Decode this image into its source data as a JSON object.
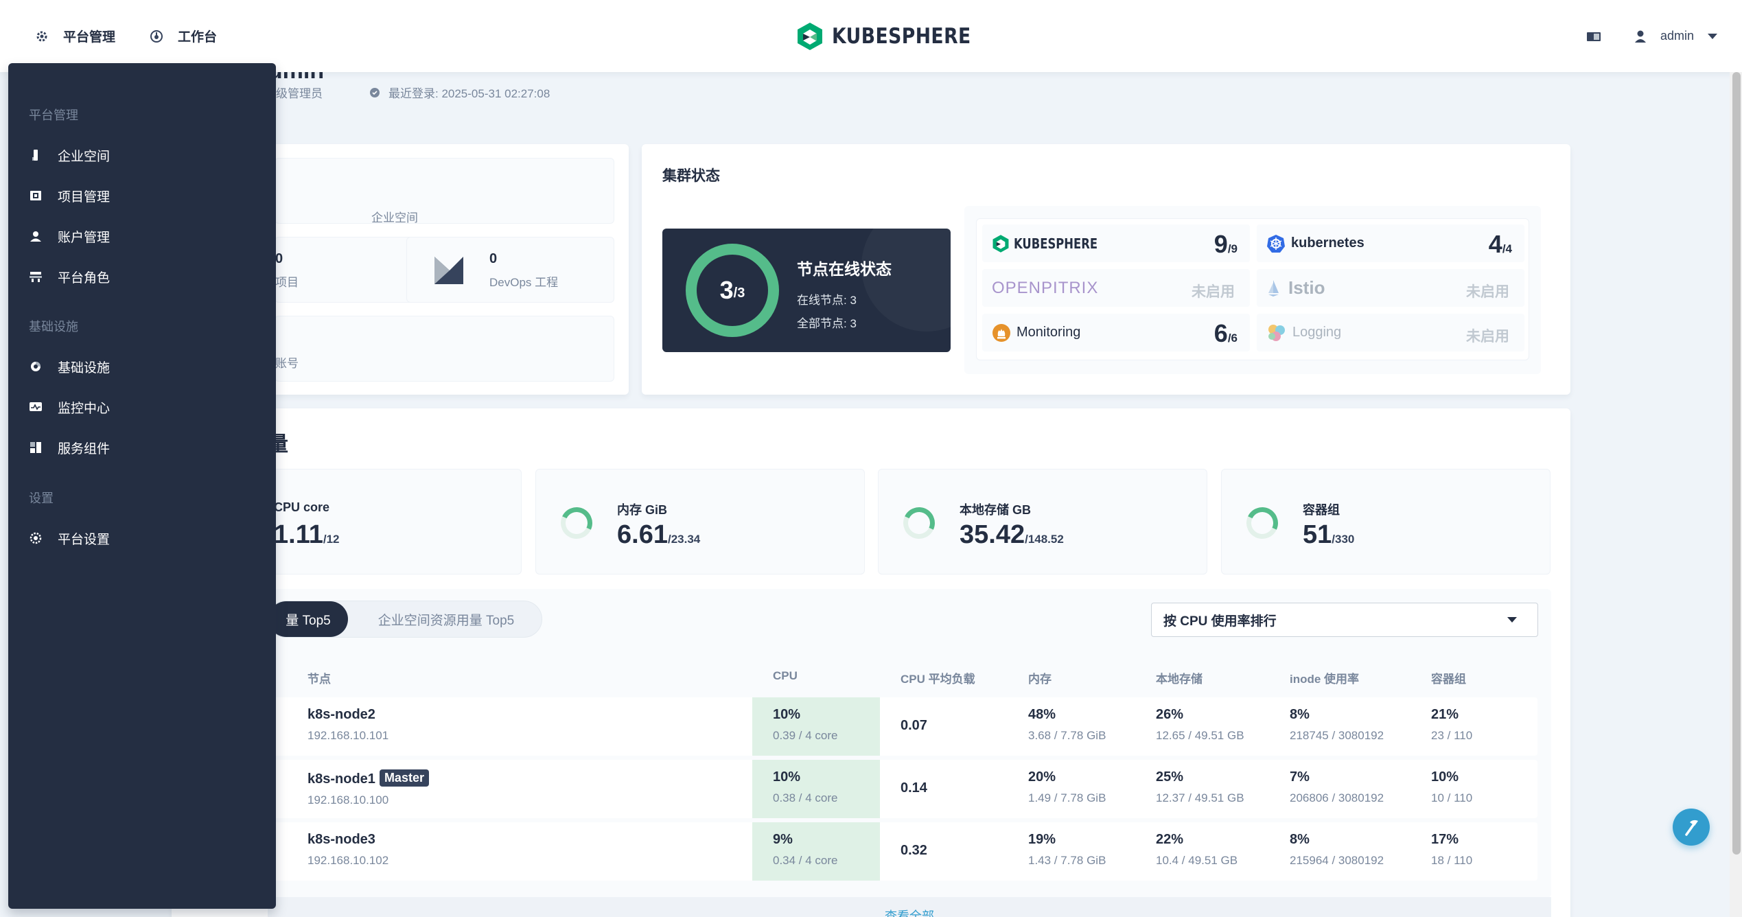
{
  "header": {
    "platform_label": "平台管理",
    "workbench_label": "工作台",
    "logo_text": "KUBESPHERE",
    "user": "admin"
  },
  "welcome": {
    "title_fragment": "admin",
    "role_fragment": "级管理员",
    "last_login": "最近登录: 2025-05-31 02:27:08"
  },
  "overview": {
    "workspace_label_fragment": "企业空间",
    "projects_value": "0",
    "projects_label_fragment": "项目",
    "devops_value": "0",
    "devops_label": "DevOps 工程",
    "accounts_label_fragment": "账号"
  },
  "cluster_status": {
    "title": "集群状态",
    "online_num": "3",
    "total_num": "/3",
    "heading": "节点在线状态",
    "online_label": "在线节点: 3",
    "total_label": "全部节点: 3",
    "components": [
      {
        "name": "KUBESPHERE",
        "value": "9",
        "total": "/9",
        "enabled": true
      },
      {
        "name": "kubernetes",
        "value": "4",
        "total": "/4",
        "enabled": true
      },
      {
        "name": "OPENPITRIX",
        "status": "未启用",
        "enabled": false
      },
      {
        "name": "Istio",
        "status": "未启用",
        "enabled": false
      },
      {
        "name": "Monitoring",
        "value": "6",
        "total": "/6",
        "enabled": true
      },
      {
        "name": "Logging",
        "status": "未启用",
        "enabled": false
      }
    ]
  },
  "resources": {
    "section_title_fragment": "量",
    "cpu": {
      "label": "CPU core",
      "value": "1.11",
      "total": "/12",
      "usage": 0.09
    },
    "memory": {
      "label": "内存 GiB",
      "value": "6.61",
      "total": "/23.34",
      "usage": 0.28
    },
    "storage": {
      "label": "本地存储 GB",
      "value": "35.42",
      "total": "/148.52",
      "usage": 0.24
    },
    "pods": {
      "label": "容器组",
      "value": "51",
      "total": "/330",
      "usage": 0.15
    }
  },
  "tabs": {
    "active": "量 Top5",
    "inactive": "企业空间资源用量 Top5"
  },
  "sort_select": {
    "value": "按 CPU 使用率排行"
  },
  "table": {
    "headers": {
      "node": "节点",
      "cpu": "CPU",
      "load": "CPU 平均负载",
      "memory": "内存",
      "storage": "本地存储",
      "inode": "inode 使用率",
      "pods": "容器组"
    },
    "rows": [
      {
        "name": "k8s-node2",
        "ip": "192.168.10.101",
        "badge": "",
        "cpu": "10%",
        "cpu_sub": "0.39 / 4 core",
        "load": "0.07",
        "mem": "48%",
        "mem_sub": "3.68 / 7.78 GiB",
        "disk": "26%",
        "disk_sub": "12.65 / 49.51 GB",
        "inode": "8%",
        "inode_sub": "218745 / 3080192",
        "pods": "21%",
        "pods_sub": "23 / 110"
      },
      {
        "name": "k8s-node1",
        "ip": "192.168.10.100",
        "badge": "Master",
        "cpu": "10%",
        "cpu_sub": "0.38 / 4 core",
        "load": "0.14",
        "mem": "20%",
        "mem_sub": "1.49 / 7.78 GiB",
        "disk": "25%",
        "disk_sub": "12.37 / 49.51 GB",
        "inode": "7%",
        "inode_sub": "206806 / 3080192",
        "pods": "10%",
        "pods_sub": "10 / 110"
      },
      {
        "name": "k8s-node3",
        "ip": "192.168.10.102",
        "badge": "",
        "cpu": "9%",
        "cpu_sub": "0.34 / 4 core",
        "load": "0.32",
        "mem": "19%",
        "mem_sub": "1.43 / 7.78 GiB",
        "disk": "22%",
        "disk_sub": "10.4 / 49.51 GB",
        "inode": "8%",
        "inode_sub": "215964 / 3080192",
        "pods": "17%",
        "pods_sub": "18 / 110"
      }
    ],
    "view_all": "查看全部"
  },
  "sidebar": {
    "groups": [
      {
        "title": "平台管理",
        "items": [
          {
            "label": "企业空间",
            "icon": "enterprise-icon"
          },
          {
            "label": "项目管理",
            "icon": "project-icon"
          },
          {
            "label": "账户管理",
            "icon": "account-icon"
          },
          {
            "label": "平台角色",
            "icon": "role-icon"
          }
        ]
      },
      {
        "title": "基础设施",
        "items": [
          {
            "label": "基础设施",
            "icon": "infrastructure-icon"
          },
          {
            "label": "监控中心",
            "icon": "monitoring-icon"
          },
          {
            "label": "服务组件",
            "icon": "components-icon"
          }
        ]
      },
      {
        "title": "设置",
        "items": [
          {
            "label": "平台设置",
            "icon": "settings-icon"
          }
        ]
      }
    ]
  },
  "colors": {
    "brand_dark": "#242e42",
    "accent_green": "#55bc8a",
    "link_blue": "#329dce",
    "muted_text": "#79879c",
    "background": "#eff4f9"
  }
}
